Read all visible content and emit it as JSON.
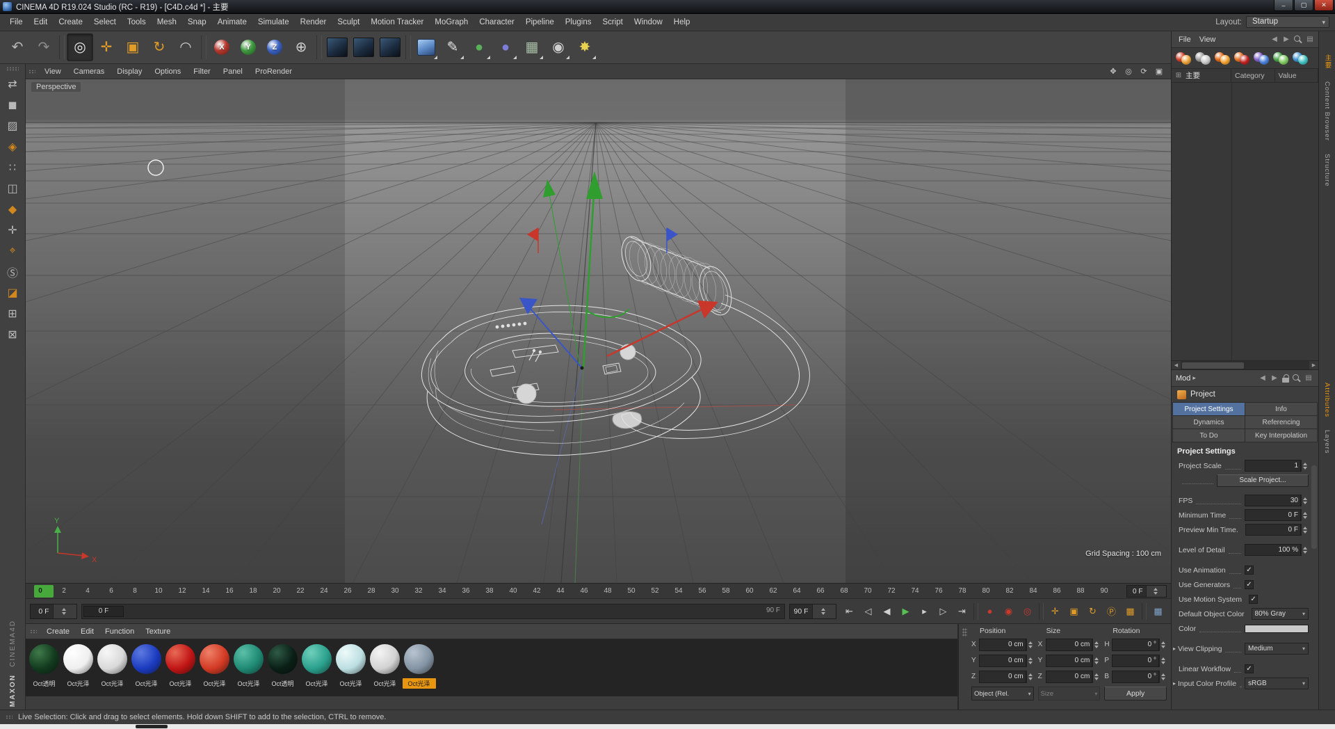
{
  "glyphs": {
    "check": "✓",
    "dropdown_arrow": "▾",
    "expander": "▶",
    "menu_arrow": "▸",
    "grip": "▤"
  },
  "titlebar": {
    "title": "CINEMA 4D R19.024 Studio (RC - R19) - [C4D.c4d *] - 主要",
    "minimize_glyph": "–",
    "maximize_glyph": "▢",
    "close_glyph": "✕"
  },
  "menubar": {
    "items": [
      "File",
      "Edit",
      "Create",
      "Select",
      "Tools",
      "Mesh",
      "Snap",
      "Animate",
      "Simulate",
      "Render",
      "Sculpt",
      "Motion Tracker",
      "MoGraph",
      "Character",
      "Pipeline",
      "Plugins",
      "Script",
      "Window",
      "Help"
    ],
    "layout_label": "Layout:",
    "layout_value": "Startup"
  },
  "toolbar": {
    "buttons": [
      {
        "name": "undo-button",
        "glyph": "↶",
        "fg": "#b9b9b9"
      },
      {
        "name": "redo-button",
        "glyph": "↷",
        "fg": "#8d8d8d"
      },
      {
        "sep": true
      },
      {
        "name": "live-selection-tool",
        "glyph": "◎",
        "fg": "#ececec",
        "pressed": true
      },
      {
        "name": "move-tool",
        "glyph": "✛",
        "fg": "#e09c28"
      },
      {
        "name": "scale-tool",
        "glyph": "▣",
        "fg": "#e09c28"
      },
      {
        "name": "rotate-tool",
        "glyph": "↻",
        "fg": "#e09c28"
      },
      {
        "name": "last-used-tool",
        "glyph": "◠",
        "fg": "#cfcfcf"
      },
      {
        "sep": true
      },
      {
        "name": "lock-x-axis-button",
        "glyph": "X",
        "ball": "#b8392e"
      },
      {
        "name": "lock-y-axis-button",
        "glyph": "Y",
        "ball": "#3f9c3f"
      },
      {
        "name": "lock-z-axis-button",
        "glyph": "Z",
        "ball": "#3b62c4"
      },
      {
        "name": "coordinate-system-button",
        "glyph": "⊕",
        "fg": "#cfcfcf"
      },
      {
        "sep": true
      },
      {
        "name": "render-view-button",
        "kind": "render"
      },
      {
        "name": "render-picture-viewer-button",
        "kind": "render"
      },
      {
        "name": "render-settings-button",
        "kind": "render"
      },
      {
        "sep": true
      },
      {
        "name": "add-primitive-button",
        "kind": "cube",
        "dropdown": true
      },
      {
        "name": "add-spline-button",
        "glyph": "✎",
        "fg": "#e8e8e8",
        "dropdown": true
      },
      {
        "name": "add-generator-button",
        "glyph": "●",
        "fg": "#58b058",
        "dropdown": true
      },
      {
        "name": "add-deformer-button",
        "glyph": "●",
        "fg": "#7d7dd8",
        "dropdown": true
      },
      {
        "name": "add-environment-button",
        "glyph": "▦",
        "fg": "#a8c0a8",
        "dropdown": true
      },
      {
        "name": "add-camera-button",
        "glyph": "◉",
        "fg": "#cfcfcf",
        "dropdown": true
      },
      {
        "name": "add-light-button",
        "glyph": "✸",
        "fg": "#e8d050",
        "dropdown": true
      }
    ]
  },
  "sidebar": {
    "buttons": [
      {
        "name": "make-editable-button",
        "glyph": "⇄",
        "fg": "#c0c0c0"
      },
      {
        "name": "model-mode-button",
        "glyph": "◼",
        "fg": "#b8b8b8"
      },
      {
        "name": "texture-mode-button",
        "glyph": "▨",
        "fg": "#b8b8b8"
      },
      {
        "name": "workplane-mode-button",
        "glyph": "◈",
        "fg": "#d0881f"
      },
      {
        "name": "points-mode-button",
        "glyph": "∷",
        "fg": "#b8b8b8"
      },
      {
        "name": "edges-mode-button",
        "glyph": "◫",
        "fg": "#b8b8b8"
      },
      {
        "name": "polygons-mode-button",
        "glyph": "◆",
        "fg": "#d0881f"
      },
      {
        "name": "enable-axis-button",
        "glyph": "✛",
        "fg": "#b8b8b8"
      },
      {
        "name": "snap-tool-button",
        "glyph": "⌖",
        "fg": "#d0881f"
      },
      {
        "name": "viewport-solo-button",
        "glyph": "Ⓢ",
        "fg": "#b8b8b8"
      },
      {
        "name": "paint-tool-button",
        "glyph": "◪",
        "fg": "#d0881f"
      },
      {
        "name": "lock-workplane-button",
        "glyph": "⊞",
        "fg": "#b8b8b8"
      },
      {
        "name": "snap-settings-button",
        "glyph": "⊠",
        "fg": "#b8b8b8"
      }
    ]
  },
  "viewport": {
    "menu_items": [
      "View",
      "Cameras",
      "Display",
      "Options",
      "Filter",
      "Panel",
      "ProRender"
    ],
    "nav_icons": [
      {
        "name": "pan-view-icon",
        "glyph": "✥"
      },
      {
        "name": "zoom-view-icon",
        "glyph": "◎"
      },
      {
        "name": "rotate-view-icon",
        "glyph": "⟳"
      },
      {
        "name": "toggle-view-icon",
        "glyph": "▣"
      }
    ],
    "view_label": "Perspective",
    "grid_spacing": "Grid Spacing : 100 cm",
    "axis_labels": {
      "x": "X",
      "y": "Y"
    }
  },
  "timeline": {
    "tick_step": 2,
    "tick_max": 90,
    "marker_frame": 0,
    "ruler_field": "0 F",
    "left_field": "0 F",
    "range_start": "0 F",
    "range_end": "90 F",
    "right_field": "90 F"
  },
  "transport": {
    "buttons": [
      {
        "name": "goto-start-button",
        "glyph": "⇤"
      },
      {
        "name": "goto-prev-key-button",
        "glyph": "◁"
      },
      {
        "name": "goto-prev-frame-button",
        "glyph": "◀"
      },
      {
        "name": "play-button",
        "glyph": "▶",
        "fg": "#58c052"
      },
      {
        "name": "goto-next-frame-button",
        "glyph": "▸"
      },
      {
        "name": "goto-next-key-button",
        "glyph": "▷"
      },
      {
        "name": "goto-end-button",
        "glyph": "⇥"
      },
      {
        "sep": true
      },
      {
        "name": "record-keyframe-button",
        "glyph": "●",
        "fg": "#cc3a2e"
      },
      {
        "name": "autokeying-button",
        "glyph": "◉",
        "fg": "#cc3a2e"
      },
      {
        "name": "record-options-button",
        "glyph": "◎",
        "fg": "#cc3a2e"
      },
      {
        "sep": true
      },
      {
        "name": "record-position-toggle",
        "glyph": "✛",
        "fg": "#e09c28"
      },
      {
        "name": "record-scale-toggle",
        "glyph": "▣",
        "fg": "#e09c28"
      },
      {
        "name": "record-rotation-toggle",
        "glyph": "↻",
        "fg": "#e09c28"
      },
      {
        "name": "record-parameter-toggle",
        "glyph": "Ⓟ",
        "fg": "#e09c28"
      },
      {
        "name": "record-pla-toggle",
        "glyph": "▦",
        "fg": "#e09c28"
      },
      {
        "sep": true
      },
      {
        "name": "keyframe-selection-button",
        "glyph": "▦",
        "fg": "#7fa3c8"
      }
    ]
  },
  "materials": {
    "menu_items": [
      "Create",
      "Edit",
      "Function",
      "Texture"
    ],
    "items": [
      {
        "label": "Oct透明",
        "color": "#123a1e",
        "hi": "#3f7a4a"
      },
      {
        "label": "Oct光泽",
        "color": "#efefef",
        "hi": "#ffffff"
      },
      {
        "label": "Oct光泽",
        "color": "#d9d9d9",
        "hi": "#f7f7f7"
      },
      {
        "label": "Oct光泽",
        "color": "#1b3bc0",
        "hi": "#5d7ae0"
      },
      {
        "label": "Oct光泽",
        "color": "#c01515",
        "hi": "#e86a55"
      },
      {
        "label": "Oct光泽",
        "color": "#d23a24",
        "hi": "#ef8068"
      },
      {
        "label": "Oct光泽",
        "color": "#1f8a74",
        "hi": "#5cc0a8"
      },
      {
        "label": "Oct透明",
        "color": "#0a1f16",
        "hi": "#2e5a46"
      },
      {
        "label": "Oct光泽",
        "color": "#2aa08c",
        "hi": "#6fd0bc"
      },
      {
        "label": "Oct光泽",
        "color": "#bcdfe2",
        "hi": "#eefafa"
      },
      {
        "label": "Oct光泽",
        "color": "#d2d2d2",
        "hi": "#f4f4f4"
      },
      {
        "label": "Oct光泽",
        "color": "#8494a4",
        "hi": "#b8c4d0",
        "selected": true
      }
    ]
  },
  "coordinates": {
    "columns": [
      {
        "title": "Position",
        "rows": [
          {
            "axis": "X",
            "value": "0 cm"
          },
          {
            "axis": "Y",
            "value": "0 cm"
          },
          {
            "axis": "Z",
            "value": "0 cm"
          }
        ],
        "footer": {
          "type": "dropdown",
          "value": "Object (Rel."
        }
      },
      {
        "title": "Size",
        "rows": [
          {
            "axis": "X",
            "value": "0 cm"
          },
          {
            "axis": "Y",
            "value": "0 cm"
          },
          {
            "axis": "Z",
            "value": "0 cm"
          }
        ],
        "footer": {
          "type": "dropdown",
          "value": "Size",
          "disabled": true
        }
      },
      {
        "title": "Rotation",
        "rows": [
          {
            "axis": "H",
            "value": "0 °"
          },
          {
            "axis": "P",
            "value": "0 °"
          },
          {
            "axis": "B",
            "value": "0 °"
          }
        ],
        "footer": {
          "type": "button",
          "value": "Apply"
        }
      }
    ]
  },
  "browser": {
    "menu_items": [
      "File",
      "View"
    ],
    "header_icons": [
      {
        "name": "nav-back-icon",
        "glyph": "◀"
      },
      {
        "name": "nav-forward-icon",
        "glyph": "▶"
      },
      {
        "name": "search-icon",
        "css": "search"
      },
      {
        "name": "panel-menu-icon",
        "glyph": "▤"
      }
    ],
    "icons": [
      {
        "name": "octane-material-icon",
        "c1": "#d04028",
        "c2": "#e8a038"
      },
      {
        "name": "octane-tool-icon",
        "c1": "#9a9a9a",
        "c2": "#c8c8c8"
      },
      {
        "name": "octane-logo-icon",
        "c1": "#e06818",
        "c2": "#f0a030"
      },
      {
        "name": "octane-spheres-red-icon",
        "c1": "#e07020",
        "c2": "#c02020"
      },
      {
        "name": "octane-spheres-purple-icon",
        "c1": "#8060c8",
        "c2": "#4880d8"
      },
      {
        "name": "octane-spheres-green-icon",
        "c1": "#48a048",
        "c2": "#80c860"
      },
      {
        "name": "octane-spheres-blue-icon",
        "c1": "#4090d0",
        "c2": "#40c0c0"
      }
    ],
    "tree_root": "主要",
    "columns": [
      "Category",
      "Value"
    ]
  },
  "attributes": {
    "mode_label": "Mod",
    "header_icons": [
      {
        "name": "history-back-icon",
        "glyph": "◀"
      },
      {
        "name": "history-forward-icon",
        "glyph": "▶"
      },
      {
        "name": "lock-icon",
        "css": "lock"
      },
      {
        "name": "search-icon",
        "css": "search"
      },
      {
        "name": "panel-menu-icon",
        "glyph": "▤"
      }
    ],
    "object_label": "Project",
    "tabs": [
      {
        "label": "Project Settings",
        "active": true
      },
      {
        "label": "Info"
      },
      {
        "label": "Dynamics"
      },
      {
        "label": "Referencing"
      },
      {
        "label": "To Do"
      },
      {
        "label": "Key Interpolation"
      }
    ],
    "section_title": "Project Settings",
    "fields": [
      {
        "label": "Project Scale",
        "type": "number",
        "value": "1"
      },
      {
        "label": "",
        "type": "button",
        "value": "Scale Project..."
      },
      {
        "label": "FPS",
        "type": "number",
        "value": "30",
        "gap_before": true
      },
      {
        "label": "Minimum Time",
        "type": "number",
        "value": "0 F"
      },
      {
        "label": "Preview Min Time.",
        "type": "number",
        "value": "0 F"
      },
      {
        "label": "Level of Detail",
        "type": "number",
        "value": "100 %",
        "gap_before": true
      },
      {
        "label": "Use Animation",
        "type": "check",
        "checked": true,
        "gap_before": true
      },
      {
        "label": "Use Generators",
        "type": "check",
        "checked": true
      },
      {
        "label": "Use Motion System",
        "type": "check",
        "checked": true
      },
      {
        "label": "Default Object Color",
        "type": "dropdown",
        "value": "80% Gray"
      },
      {
        "label": "Color",
        "type": "color",
        "value": "#c9c9c9"
      },
      {
        "label": "View Clipping",
        "type": "dropdown",
        "value": "Medium",
        "expander": true,
        "gap_before": true
      },
      {
        "label": "Linear Workflow",
        "type": "check",
        "checked": true,
        "gap_before": true
      },
      {
        "label": "Input Color Profile",
        "type": "dropdown",
        "value": "sRGB",
        "expander": true
      }
    ]
  },
  "right_strip": {
    "tabs_top": [
      {
        "label": "主要",
        "active": true
      },
      {
        "label": "Content Browser"
      },
      {
        "label": "Structure"
      }
    ],
    "tabs_bottom": [
      {
        "label": "Attributes",
        "active": true
      },
      {
        "label": "Layers"
      }
    ]
  },
  "branding": {
    "vertical_top": "CINEMA4D",
    "vertical_bottom": "MAXON"
  },
  "statusbar": {
    "text": "Live Selection: Click and drag to select elements. Hold down SHIFT to add to the selection, CTRL to remove."
  }
}
